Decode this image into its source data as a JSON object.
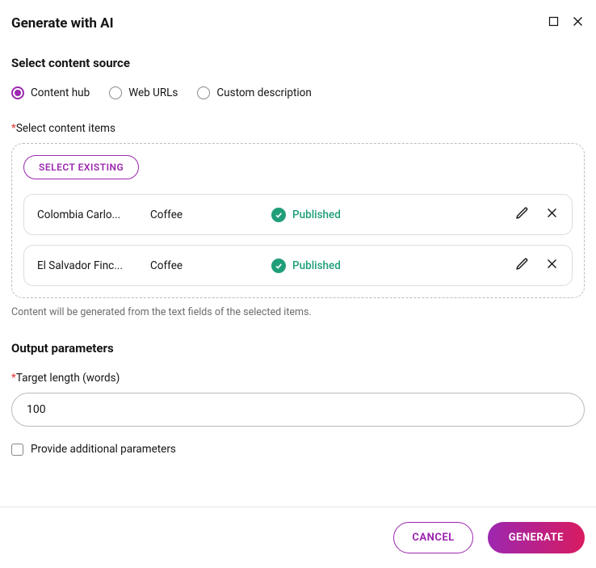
{
  "header": {
    "title": "Generate with AI"
  },
  "source": {
    "section_title": "Select content source",
    "options": [
      {
        "label": "Content hub"
      },
      {
        "label": "Web URLs"
      },
      {
        "label": "Custom description"
      }
    ],
    "field_label": "Select content items",
    "select_button": "SELECT EXISTING",
    "items": [
      {
        "name": "Colombia Carlo...",
        "type": "Coffee",
        "status": "Published"
      },
      {
        "name": "El Salvador Finc...",
        "type": "Coffee",
        "status": "Published"
      }
    ],
    "help_text": "Content will be generated from the text fields of the selected items."
  },
  "output": {
    "section_title": "Output parameters",
    "length_label": "Target length (words)",
    "length_value": "100",
    "additional_label": "Provide additional parameters"
  },
  "footer": {
    "cancel": "CANCEL",
    "generate": "GENERATE"
  }
}
